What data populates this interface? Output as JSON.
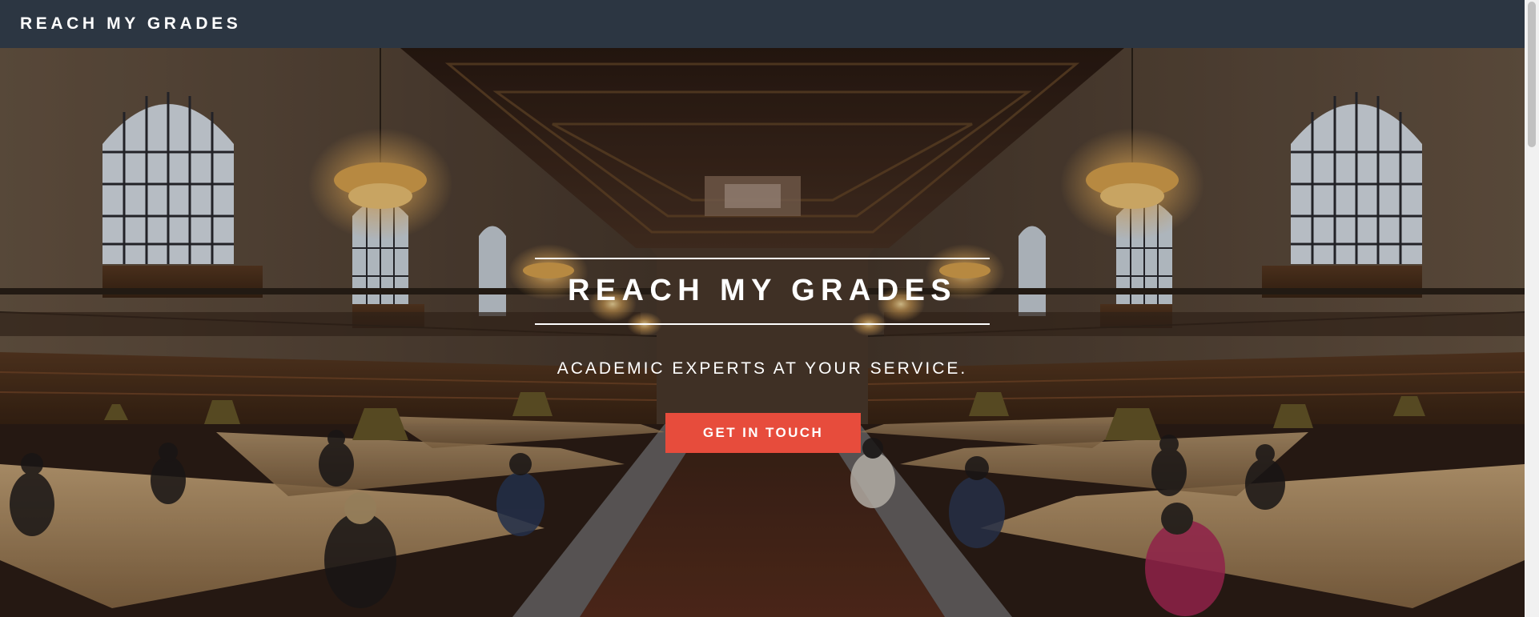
{
  "navbar": {
    "brand": "REACH MY GRADES"
  },
  "hero": {
    "title": "REACH MY GRADES",
    "subtitle": "ACADEMIC EXPERTS AT YOUR SERVICE.",
    "cta_label": "GET IN TOUCH",
    "background_description_icon": "library-reading-room-image"
  },
  "colors": {
    "navbar_bg": "#2c3642",
    "accent": "#e74c3c",
    "text": "#ffffff"
  }
}
